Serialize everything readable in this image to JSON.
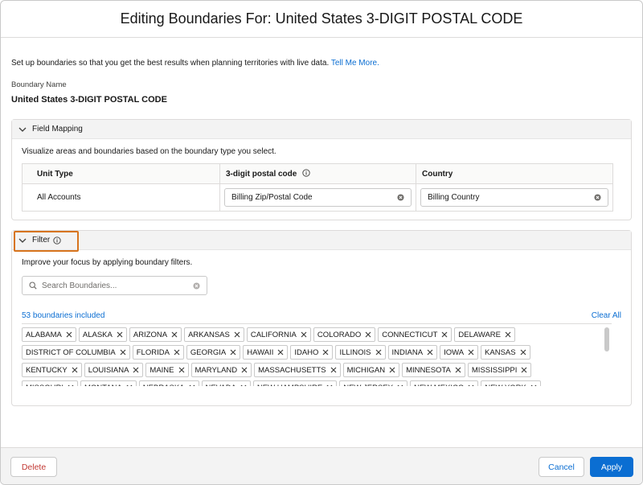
{
  "modal": {
    "title": "Editing Boundaries For: United States 3-DIGIT POSTAL CODE",
    "intro_text": "Set up boundaries so that you get the best results when planning territories with live data.",
    "intro_link": "Tell Me More.",
    "boundary_name_label": "Boundary Name",
    "boundary_name_value": "United States 3-DIGIT POSTAL CODE"
  },
  "field_mapping": {
    "title": "Field Mapping",
    "description": "Visualize areas and boundaries based on the boundary type you select.",
    "headers": [
      "Unit Type",
      "3-digit postal code",
      "Country"
    ],
    "unit_type_value": "All Accounts",
    "postal_field_value": "Billing Zip/Postal Code",
    "country_field_value": "Billing Country"
  },
  "filter": {
    "title": "Filter",
    "description": "Improve your focus by applying boundary filters.",
    "search_placeholder": "Search Boundaries...",
    "included_count": "53 boundaries included",
    "clear_all": "Clear All",
    "rows": [
      [
        "ALABAMA",
        "ALASKA",
        "ARIZONA",
        "ARKANSAS",
        "CALIFORNIA",
        "COLORADO",
        "CONNECTICUT",
        "DELAWARE"
      ],
      [
        "DISTRICT OF COLUMBIA",
        "FLORIDA",
        "GEORGIA",
        "HAWAII",
        "IDAHO",
        "ILLINOIS",
        "INDIANA",
        "IOWA",
        "KANSAS"
      ],
      [
        "KENTUCKY",
        "LOUISIANA",
        "MAINE",
        "MARYLAND",
        "MASSACHUSETTS",
        "MICHIGAN",
        "MINNESOTA",
        "MISSISSIPPI"
      ],
      [
        "MISSOURI",
        "MONTANA",
        "NEBRASKA",
        "NEVADA",
        "NEW HAMPSHIRE",
        "NEW JERSEY",
        "NEW MEXICO",
        "NEW YORK"
      ]
    ]
  },
  "footer": {
    "delete_label": "Delete",
    "cancel_label": "Cancel",
    "apply_label": "Apply"
  },
  "colors": {
    "brand_blue": "#0b6ed2",
    "delete_red": "#c23934",
    "highlight_orange": "#d7741d"
  },
  "icons": {
    "chevron": "chevron-down-icon",
    "info": "info-icon",
    "clear": "clear-circle-icon",
    "search": "search-icon",
    "remove": "close-icon"
  }
}
